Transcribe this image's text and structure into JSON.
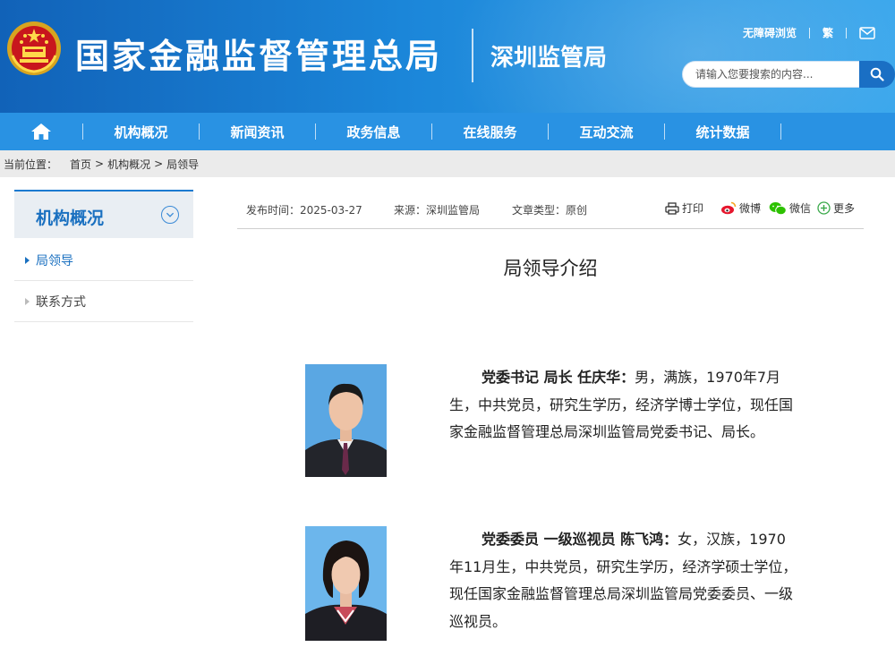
{
  "header": {
    "site_title": "国家金融监督管理总局",
    "sub_title": "深圳监管局",
    "accessibility_link": "无障碍浏览",
    "traditional_link": "繁",
    "search_placeholder": "请输入您要搜索的内容...",
    "brand_color": "#1b86d9"
  },
  "nav": {
    "items": [
      "机构概况",
      "新闻资讯",
      "政务信息",
      "在线服务",
      "互动交流",
      "统计数据"
    ]
  },
  "breadcrumb": {
    "label": "当前位置：",
    "items": [
      "首页",
      "机构概况",
      "局领导"
    ],
    "separator": ">"
  },
  "sidebar": {
    "title": "机构概况",
    "items": [
      {
        "label": "局领导",
        "active": true
      },
      {
        "label": "联系方式",
        "active": false
      }
    ]
  },
  "meta": {
    "publish_time": "发布时间：2025-03-27",
    "source": "来源：深圳监管局",
    "type": "文章类型：原创",
    "print": "打印",
    "weibo": "微博",
    "wechat": "微信",
    "more": "更多"
  },
  "article": {
    "title": "局领导介绍",
    "leaders": [
      {
        "role_name": "党委书记 局长 任庆华：",
        "bio": "男，满族，1970年7月生，中共党员，研究生学历，经济学博士学位，现任国家金融监督管理总局深圳监管局党委书记、局长。"
      },
      {
        "role_name": "党委委员 一级巡视员 陈飞鸿：",
        "bio": "女，汉族，1970年11月生，中共党员，研究生学历，经济学硕士学位，现任国家金融监督管理总局深圳监管局党委委员、一级巡视员。"
      }
    ]
  }
}
